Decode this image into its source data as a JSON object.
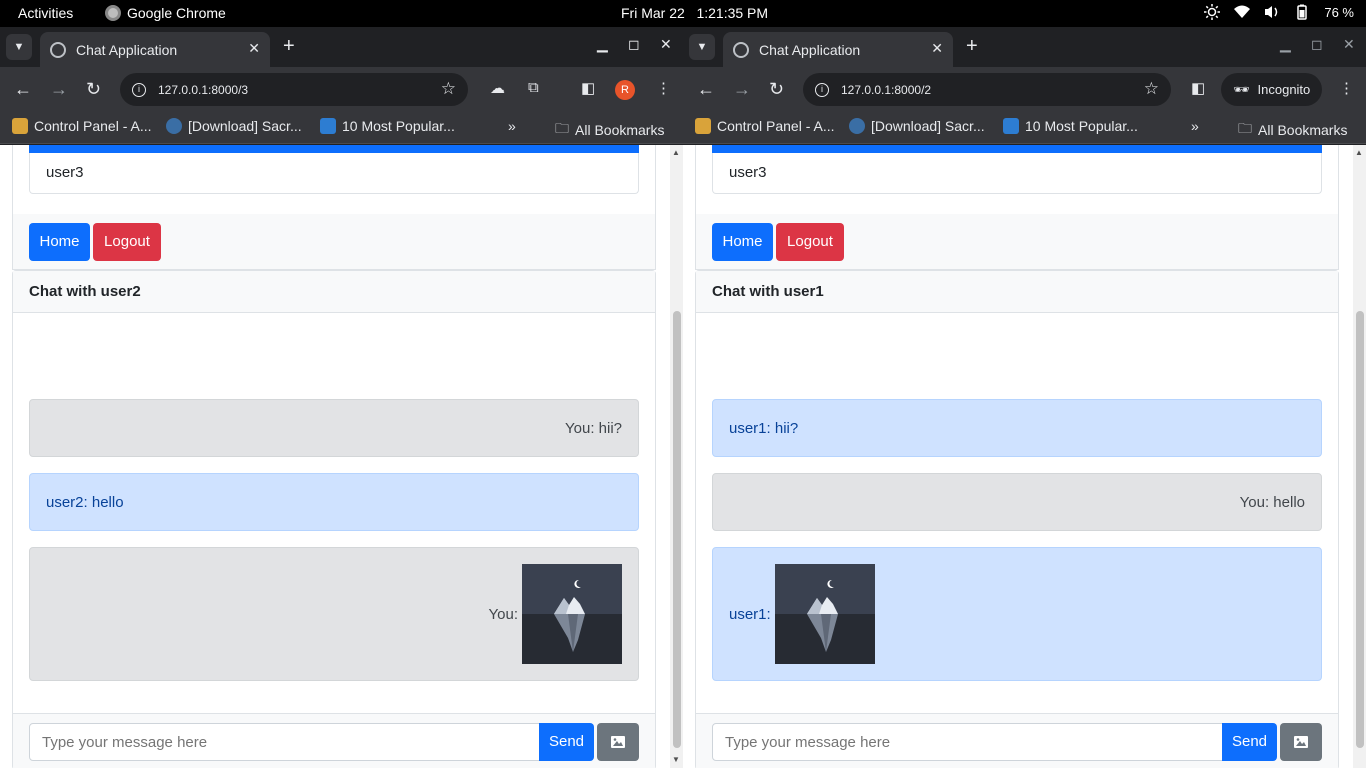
{
  "system_bar": {
    "activities": "Activities",
    "app_name": "Google Chrome",
    "datetime": "Fri Mar 22   1:21:35 PM",
    "battery": "76 %"
  },
  "icons": {
    "tab_search": "chevron-down-icon",
    "tab_favicon": "globe-icon",
    "back": "arrow-left-icon",
    "forward": "arrow-right-icon",
    "reload": "reload-icon",
    "site_info": "info-icon",
    "bookmark_star": "star-icon",
    "image_button": "image-icon"
  },
  "colors": {
    "primary": "#0d6efd",
    "danger": "#dc3545",
    "secondary": "#6c757d",
    "mine_bubble": "#e2e3e5",
    "their_bubble": "#cfe2ff"
  },
  "windows": [
    {
      "tab_title": "Chat Application",
      "url": "127.0.0.1:8000/3",
      "profile_initial": "R",
      "bookmarks": [
        "Control Panel - A...",
        "[Download] Sacr...",
        "10 Most Popular...",
        "»",
        "All Bookmarks"
      ],
      "current_user": "user3",
      "home_label": "Home",
      "logout_label": "Logout",
      "chat_title": "Chat with user2",
      "messages": [
        {
          "text": "You: hii?",
          "own": true
        },
        {
          "text": "user2: hello",
          "own": false
        },
        {
          "text": "You:",
          "own": true,
          "image": "iceberg-image"
        }
      ],
      "input_placeholder": "Type your message here",
      "send_label": "Send"
    },
    {
      "tab_title": "Chat Application",
      "url": "127.0.0.1:8000/2",
      "incognito_label": "Incognito",
      "bookmarks": [
        "Control Panel - A...",
        "[Download] Sacr...",
        "10 Most Popular...",
        "»",
        "All Bookmarks"
      ],
      "current_user": "user3",
      "home_label": "Home",
      "logout_label": "Logout",
      "chat_title": "Chat with user1",
      "messages": [
        {
          "text": "user1: hii?",
          "own": false
        },
        {
          "text": "You: hello",
          "own": true
        },
        {
          "text": "user1:",
          "own": false,
          "image": "iceberg-image"
        }
      ],
      "input_placeholder": "Type your message here",
      "send_label": "Send"
    }
  ]
}
